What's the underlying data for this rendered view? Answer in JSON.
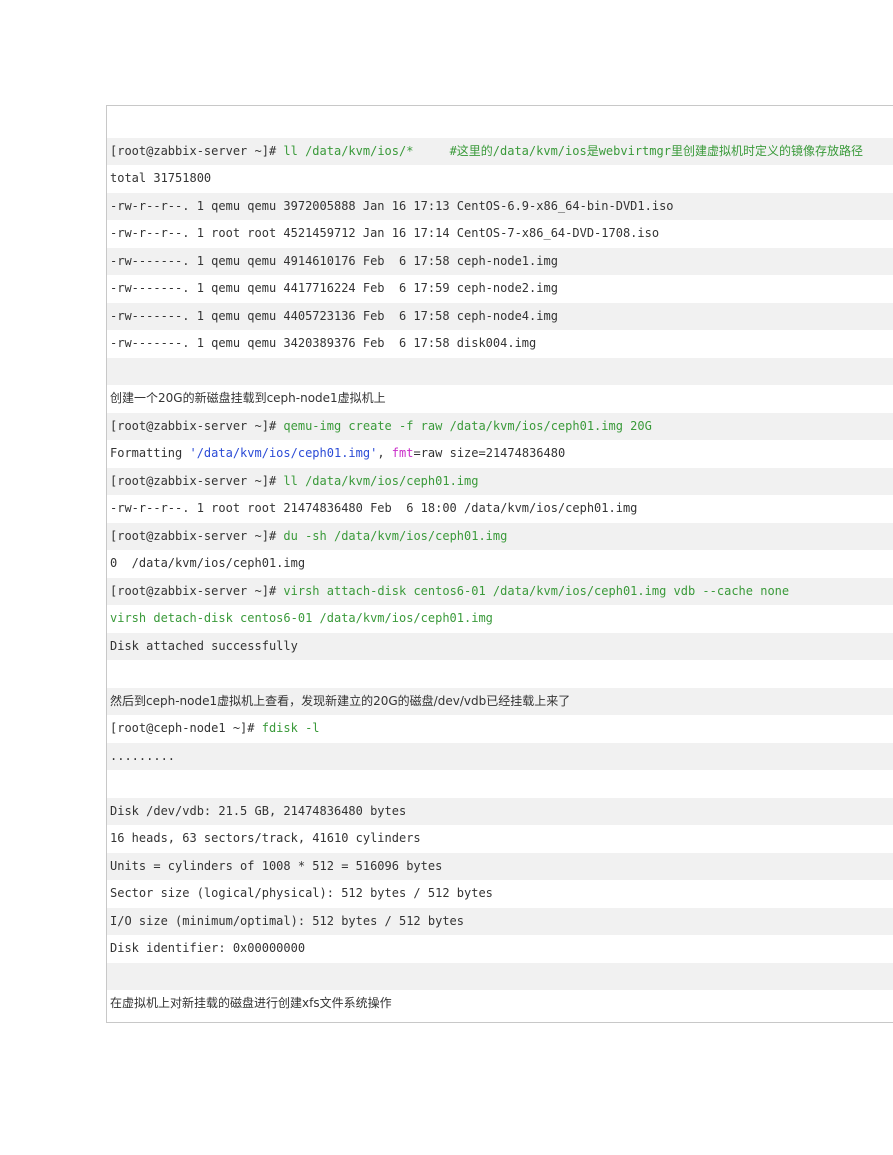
{
  "lines": [
    {
      "type": "blank"
    },
    {
      "type": "cmd",
      "prompt": "[root@zabbix-server ~]#",
      "command": " ll /data/kvm/ios/*     #这里的/data/kvm/ios是webvirtmgr里创建虚拟机时定义的镜像存放路径"
    },
    {
      "type": "out",
      "text": "total 31751800"
    },
    {
      "type": "out",
      "text": "-rw-r--r--. 1 qemu qemu 3972005888 Jan 16 17:13 CentOS-6.9-x86_64-bin-DVD1.iso"
    },
    {
      "type": "out",
      "text": "-rw-r--r--. 1 root root 4521459712 Jan 16 17:14 CentOS-7-x86_64-DVD-1708.iso"
    },
    {
      "type": "out",
      "text": "-rw-------. 1 qemu qemu 4914610176 Feb  6 17:58 ceph-node1.img"
    },
    {
      "type": "out",
      "text": "-rw-------. 1 qemu qemu 4417716224 Feb  6 17:59 ceph-node2.img"
    },
    {
      "type": "out",
      "text": "-rw-------. 1 qemu qemu 4405723136 Feb  6 17:58 ceph-node4.img"
    },
    {
      "type": "out",
      "text": "-rw-------. 1 qemu qemu 3420389376 Feb  6 17:58 disk004.img"
    },
    {
      "type": "blank"
    },
    {
      "type": "note",
      "text": "创建一个20G的新磁盘挂载到ceph-node1虚拟机上"
    },
    {
      "type": "cmd",
      "prompt": "[root@zabbix-server ~]#",
      "command": " qemu-img create -f raw /data/kvm/ios/ceph01.img 20G"
    },
    {
      "type": "fmt",
      "pre": "Formatting ",
      "path": "'/data/kvm/ios/ceph01.img'",
      "mid": ", ",
      "key": "fmt",
      "post": "=raw size=21474836480"
    },
    {
      "type": "cmd",
      "prompt": "[root@zabbix-server ~]#",
      "command": " ll /data/kvm/ios/ceph01.img"
    },
    {
      "type": "out",
      "text": "-rw-r--r--. 1 root root 21474836480 Feb  6 18:00 /data/kvm/ios/ceph01.img"
    },
    {
      "type": "cmd",
      "prompt": "[root@zabbix-server ~]#",
      "command": " du -sh /data/kvm/ios/ceph01.img"
    },
    {
      "type": "out",
      "text": "0  /data/kvm/ios/ceph01.img"
    },
    {
      "type": "cmd",
      "prompt": "[root@zabbix-server ~]#",
      "command": " virsh attach-disk centos6-01 /data/kvm/ios/ceph01.img vdb --cache none"
    },
    {
      "type": "green",
      "text": "virsh detach-disk centos6-01 /data/kvm/ios/ceph01.img"
    },
    {
      "type": "out",
      "text": "Disk attached successfully"
    },
    {
      "type": "blank"
    },
    {
      "type": "note",
      "text": "然后到ceph-node1虚拟机上查看，发现新建立的20G的磁盘/dev/vdb已经挂载上来了"
    },
    {
      "type": "cmd",
      "prompt": "[root@ceph-node1 ~]#",
      "command": " fdisk -l"
    },
    {
      "type": "out",
      "text": "........."
    },
    {
      "type": "blank"
    },
    {
      "type": "out",
      "text": "Disk /dev/vdb: 21.5 GB, 21474836480 bytes"
    },
    {
      "type": "out",
      "text": "16 heads, 63 sectors/track, 41610 cylinders"
    },
    {
      "type": "out",
      "text": "Units = cylinders of 1008 * 512 = 516096 bytes"
    },
    {
      "type": "out",
      "text": "Sector size (logical/physical): 512 bytes / 512 bytes"
    },
    {
      "type": "out",
      "text": "I/O size (minimum/optimal): 512 bytes / 512 bytes"
    },
    {
      "type": "out",
      "text": "Disk identifier: 0x00000000"
    },
    {
      "type": "blank"
    },
    {
      "type": "note",
      "text": "在虚拟机上对新挂载的磁盘进行创建xfs文件系统操作"
    }
  ]
}
